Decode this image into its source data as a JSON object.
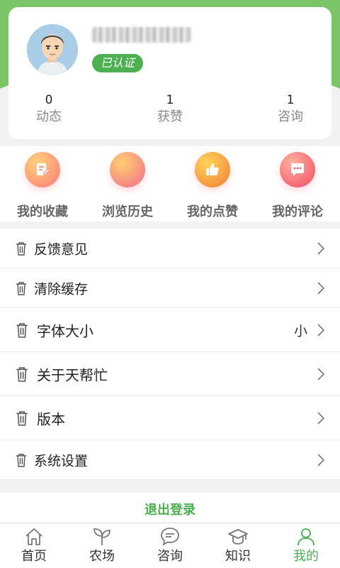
{
  "profile": {
    "verified_label": "已认证",
    "stats": [
      {
        "value": "0",
        "label": "动态"
      },
      {
        "value": "1",
        "label": "获赞"
      },
      {
        "value": "1",
        "label": "咨询"
      }
    ]
  },
  "quick_actions": [
    {
      "label": "我的收藏",
      "icon": "edit-note-icon"
    },
    {
      "label": "浏览历史",
      "icon": "history-icon"
    },
    {
      "label": "我的点赞",
      "icon": "thumbs-up-icon"
    },
    {
      "label": "我的评论",
      "icon": "comment-icon"
    }
  ],
  "menu": [
    {
      "label": "反馈意见",
      "value": ""
    },
    {
      "label": "清除缓存",
      "value": ""
    },
    {
      "label": "字体大小",
      "value": "小"
    },
    {
      "label": "关于天帮忙",
      "value": ""
    },
    {
      "label": "版本",
      "value": ""
    },
    {
      "label": "系统设置",
      "value": ""
    }
  ],
  "logout_label": "退出登录",
  "tabbar": [
    {
      "label": "首页",
      "icon": "home-icon"
    },
    {
      "label": "农场",
      "icon": "sprout-icon"
    },
    {
      "label": "咨询",
      "icon": "chat-icon"
    },
    {
      "label": "知识",
      "icon": "graduation-cap-icon"
    },
    {
      "label": "我的",
      "icon": "user-icon",
      "active": true
    }
  ],
  "colors": {
    "accent": "#4caf50",
    "header": "#7cc46a"
  }
}
